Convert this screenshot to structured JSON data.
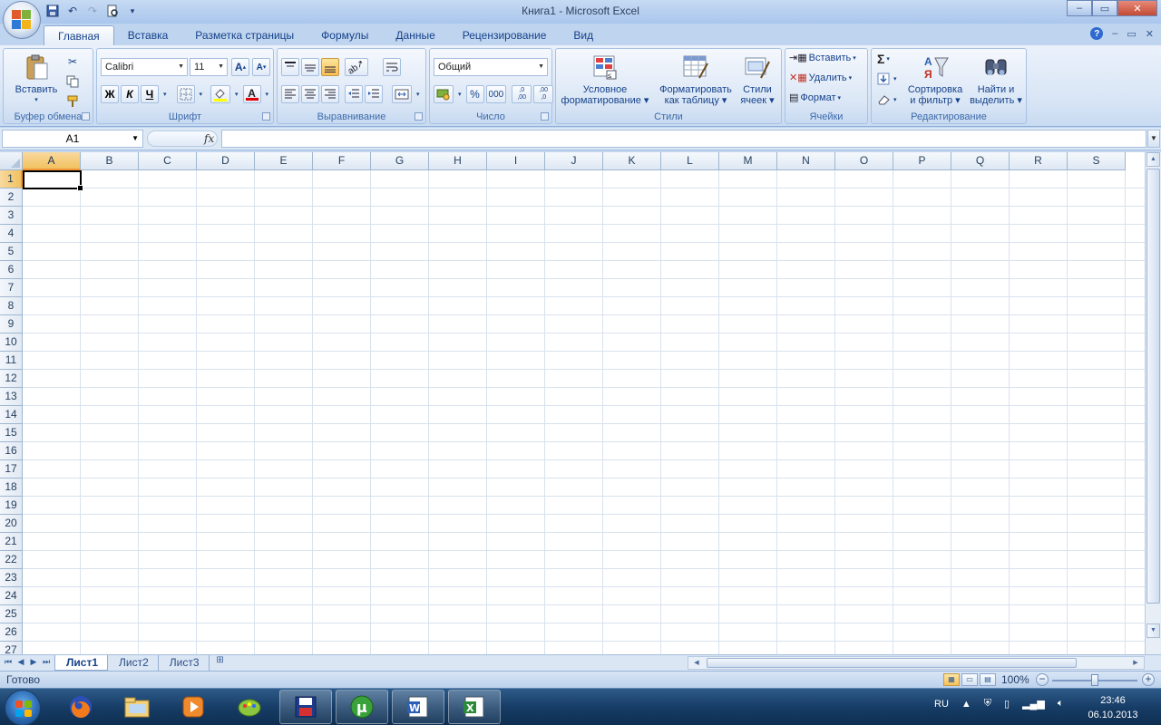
{
  "window": {
    "title": "Книга1 - Microsoft Excel",
    "controls": {
      "minimize": "–",
      "maximize": "▭",
      "close": "✕"
    }
  },
  "qat_icons": [
    "save-icon",
    "undo-icon",
    "redo-icon",
    "print-preview-icon",
    "customize-qat-icon"
  ],
  "ribbon_tabs": [
    {
      "label": "Главная",
      "active": true
    },
    {
      "label": "Вставка"
    },
    {
      "label": "Разметка страницы"
    },
    {
      "label": "Формулы"
    },
    {
      "label": "Данные"
    },
    {
      "label": "Рецензирование"
    },
    {
      "label": "Вид"
    }
  ],
  "clipboard": {
    "label": "Буфер обмена",
    "paste": "Вставить"
  },
  "font": {
    "label": "Шрифт",
    "font_name": "Calibri",
    "font_size": "11",
    "bold": "Ж",
    "italic": "К",
    "underline": "Ч",
    "grow": "A",
    "shrink": "A",
    "font_color_letter": "A"
  },
  "alignment": {
    "label": "Выравнивание"
  },
  "number": {
    "label": "Число",
    "format": "Общий",
    "percent": "%",
    "thousands": "000",
    "inc_decimal": ",0 ,00",
    "dec_decimal": ",00 ,0"
  },
  "styles": {
    "label": "Стили",
    "conditional": [
      "Условное",
      "форматирование"
    ],
    "as_table": [
      "Форматировать",
      "как таблицу"
    ],
    "cell_styles": [
      "Стили",
      "ячеек"
    ]
  },
  "cells_group": {
    "label": "Ячейки",
    "insert": "Вставить",
    "delete": "Удалить",
    "format": "Формат"
  },
  "editing": {
    "label": "Редактирование",
    "sigma": "Σ",
    "sort": [
      "Сортировка",
      "и фильтр"
    ],
    "find": [
      "Найти и",
      "выделить"
    ]
  },
  "formula_bar": {
    "name_box": "A1",
    "fx": "fx",
    "value": ""
  },
  "grid": {
    "columns": [
      "A",
      "B",
      "C",
      "D",
      "E",
      "F",
      "G",
      "H",
      "I",
      "J",
      "K",
      "L",
      "M",
      "N",
      "O",
      "P",
      "Q",
      "R",
      "S"
    ],
    "rows": [
      "1",
      "2",
      "3",
      "4",
      "5",
      "6",
      "7",
      "8",
      "9",
      "10",
      "11",
      "12",
      "13",
      "14",
      "15",
      "16",
      "17",
      "18",
      "19",
      "20",
      "21",
      "22",
      "23",
      "24",
      "25",
      "26",
      "27"
    ],
    "active_cell": "A1"
  },
  "sheets": [
    {
      "label": "Лист1",
      "active": true
    },
    {
      "label": "Лист2"
    },
    {
      "label": "Лист3"
    }
  ],
  "status": {
    "text": "Готово",
    "zoom": "100%"
  },
  "taskbar": {
    "lang": "RU",
    "time": "23:46",
    "date": "06.10.2013",
    "apps": [
      "firefox-icon",
      "explorer-icon",
      "media-player-icon",
      "paint-icon",
      "save-floppy-icon",
      "utorrent-icon",
      "word-icon",
      "excel-icon"
    ]
  },
  "colors": {
    "accent": "#15428b",
    "selected_header": "#f1c15f",
    "grid_line": "#d8e2ee"
  }
}
